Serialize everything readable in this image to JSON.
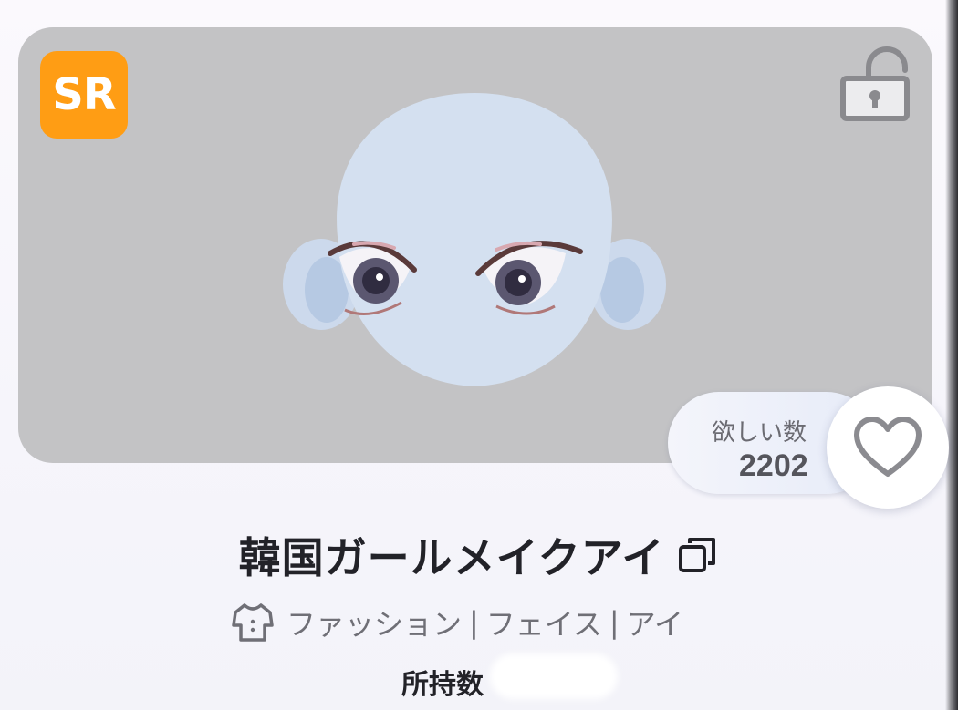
{
  "item": {
    "rarity": "SR",
    "title": "韓国ガールメイクアイ",
    "categories": [
      "ファッション",
      "フェイス",
      "アイ"
    ],
    "separator": "|",
    "owned_label": "所持数"
  },
  "wishlist": {
    "label": "欲しい数",
    "count": "2202"
  },
  "icons": {
    "lock": "unlocked-padlock-icon",
    "heart": "heart-outline-icon",
    "copy": "copy-icon",
    "category": "shirt-icon"
  },
  "colors": {
    "rarity_badge": "#ff9d14",
    "card_background": "#c3c3c5",
    "title_text": "#222228"
  }
}
